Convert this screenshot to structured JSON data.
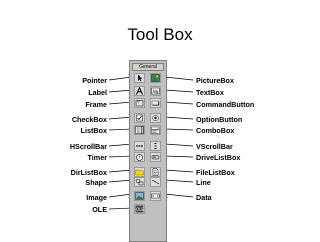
{
  "title": "Tool Box",
  "toolbox": {
    "header": "General"
  },
  "left_labels": [
    "Pointer",
    "Label",
    "Frame",
    "CheckBox",
    "ListBox",
    "HScrollBar",
    "Timer",
    "DirListBox",
    "Shape",
    "Image",
    "OLE"
  ],
  "right_labels": [
    "PictureBox",
    "TextBox",
    "CommandButton",
    "OptionButton",
    "ComboBox",
    "VScrollBar",
    "DriveListBox",
    "FileListBox",
    "Line",
    "Data"
  ]
}
